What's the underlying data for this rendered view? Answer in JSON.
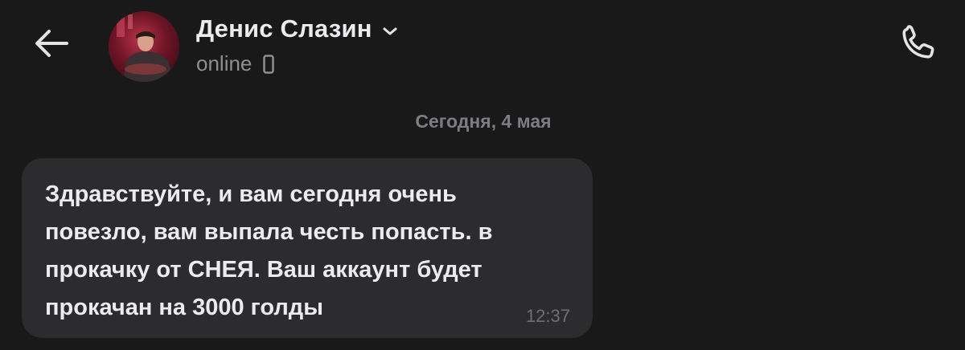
{
  "header": {
    "contact_name": "Денис Слазин",
    "status": "online",
    "icons": {
      "back": "arrow-left-icon",
      "name_dropdown": "chevron-down-icon",
      "device": "mobile-phone-icon",
      "call": "phone-call-icon"
    }
  },
  "chat": {
    "date_separator": "Сегодня, 4 мая",
    "messages": [
      {
        "text": "Здравствуйте, и вам сегодня очень\nповезло, вам выпала честь попасть. в\nпрокачку от СНЕЯ. Ваш аккаунт будет\nпрокачан на 3000 голды",
        "time": "12:37",
        "direction": "incoming"
      }
    ]
  },
  "colors": {
    "background": "#19191a",
    "bubble": "#2c2c2e",
    "text_primary": "#ececee",
    "text_secondary": "#8e8e93"
  }
}
